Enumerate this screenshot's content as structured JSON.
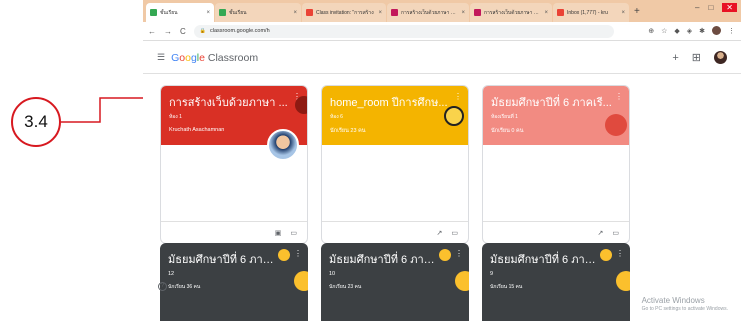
{
  "annotation": {
    "label": "3.4"
  },
  "browser": {
    "tabs": [
      {
        "label": "ชั้นเรียน",
        "favicon_color": "#34a853",
        "active": true
      },
      {
        "label": "ชั้นเรียน",
        "favicon_color": "#34a853",
        "active": false
      },
      {
        "label": "Class invitation: \"การสร้าง",
        "favicon_color": "#ea4335",
        "active": false
      },
      {
        "label": "การสร้างเว็บด้วยภาษา HTML",
        "favicon_color": "#c2185b",
        "active": false
      },
      {
        "label": "การสร้างเว็บด้วยภาษา HTML",
        "favicon_color": "#c2185b",
        "active": false
      },
      {
        "label": "Inbox (1,777) - kru",
        "favicon_color": "#ea4335",
        "active": false
      }
    ],
    "url": "classroom.google.com/h"
  },
  "appbar": {
    "brand_google": [
      "G",
      "o",
      "o",
      "g",
      "l",
      "e"
    ],
    "brand_product": "Classroom"
  },
  "classes_top": [
    {
      "title": "การสร้างเว็บด้วยภาษา ...",
      "section": "ห้อง 1",
      "teacher": "Kruchath Asachamnan",
      "color": "#d93025",
      "students": ""
    },
    {
      "title": "home_room ปีการศึกษ...",
      "section": "ห้อง 6",
      "teacher": "นักเรียน 23 คน",
      "color": "#f4b400",
      "students": ""
    },
    {
      "title": "มัธยมศึกษาปีที่ 6 ภาคเรี...",
      "section": "ห้องเรียนที่ 1",
      "teacher": "นักเรียน 0 คน",
      "color": "#f28b82",
      "students": ""
    }
  ],
  "classes_bottom": [
    {
      "title": "มัธยมศึกษาปีที่ 6 ภาคเรี...",
      "section": "12",
      "teacher": "นักเรียน 36 คน"
    },
    {
      "title": "มัธยมศึกษาปีที่ 6 ภาคเรี...",
      "section": "10",
      "teacher": "นักเรียน 23 คน"
    },
    {
      "title": "มัธยมศึกษาปีที่ 6 ภาคเรี...",
      "section": "9",
      "teacher": "นักเรียน 15 คน"
    }
  ],
  "icons": {
    "card1_foot": [
      "assignment-icon",
      "folder-icon"
    ],
    "card23_foot": [
      "trending-icon",
      "folder-icon"
    ]
  },
  "watermark": {
    "line1": "Activate Windows",
    "line2": "Go to PC settings to activate Windows."
  }
}
